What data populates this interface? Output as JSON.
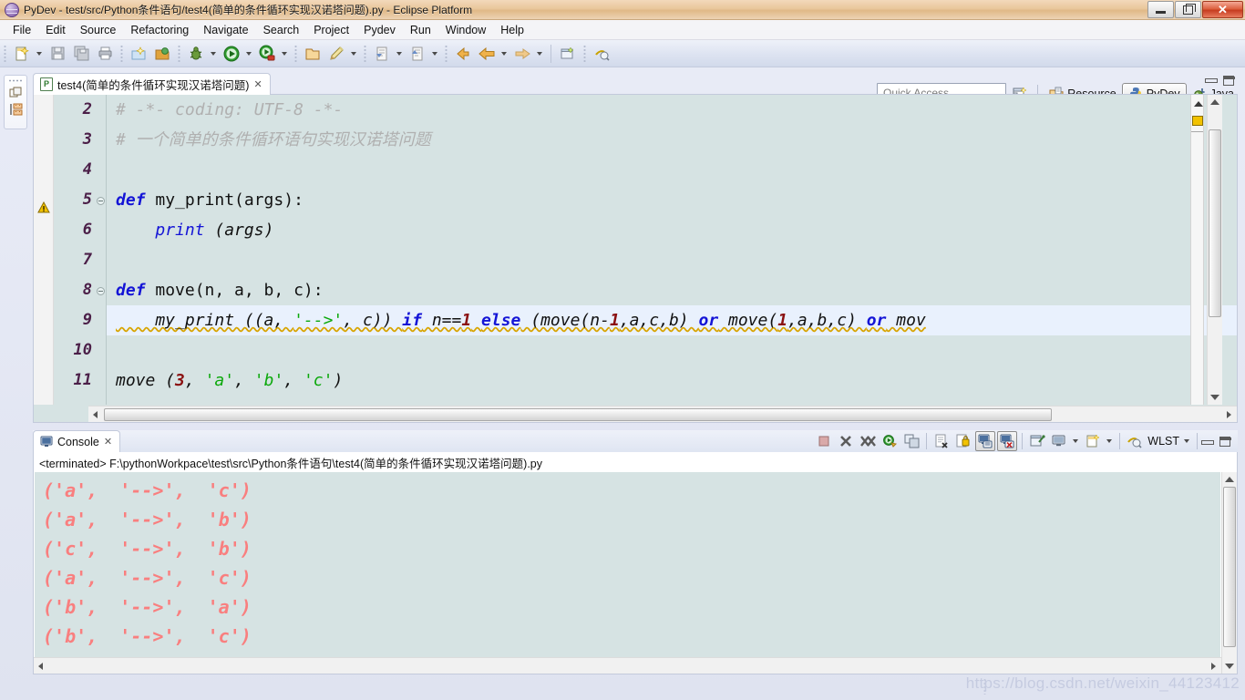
{
  "window": {
    "title": "PyDev - test/src/Python条件语句/test4(简单的条件循环实现汉诺塔问题).py - Eclipse Platform",
    "app_icon": "pydev-globe-icon",
    "minimize_label": "Minimize",
    "maximize_label": "Restore",
    "close_label": "Close"
  },
  "menubar": {
    "items": [
      {
        "label": "File"
      },
      {
        "label": "Edit"
      },
      {
        "label": "Source"
      },
      {
        "label": "Refactoring"
      },
      {
        "label": "Navigate"
      },
      {
        "label": "Search"
      },
      {
        "label": "Project"
      },
      {
        "label": "Pydev"
      },
      {
        "label": "Run"
      },
      {
        "label": "Window"
      },
      {
        "label": "Help"
      }
    ]
  },
  "toolbar": {
    "groups": [
      {
        "buttons": [
          {
            "name": "new-wizard-icon",
            "dropdown": true
          },
          {
            "name": "save-icon",
            "dropdown": false
          },
          {
            "name": "save-all-icon",
            "dropdown": false
          },
          {
            "name": "print-icon",
            "dropdown": false
          }
        ]
      },
      {
        "buttons": [
          {
            "name": "new-pydev-project-icon",
            "dropdown": false
          },
          {
            "name": "pydev-package-explorer-icon",
            "dropdown": false
          }
        ]
      },
      {
        "buttons": [
          {
            "name": "open-type-icon",
            "dropdown": false
          }
        ]
      },
      {
        "buttons": [
          {
            "name": "debug-icon",
            "dropdown": true
          },
          {
            "name": "run-icon",
            "dropdown": true
          },
          {
            "name": "run-external-tools-icon",
            "dropdown": true
          }
        ]
      },
      {
        "buttons": [
          {
            "name": "open-folder-icon",
            "dropdown": false
          },
          {
            "name": "pencil-edit-icon",
            "dropdown": true
          }
        ]
      },
      {
        "buttons": [
          {
            "name": "next-annotation-icon",
            "dropdown": true
          },
          {
            "name": "previous-annotation-icon",
            "dropdown": true
          }
        ]
      },
      {
        "buttons": [
          {
            "name": "back-history-icon",
            "dropdown": false
          },
          {
            "name": "back-arrow-icon",
            "dropdown": true
          },
          {
            "name": "forward-arrow-icon",
            "dropdown": true
          }
        ]
      },
      {
        "buttons": [
          {
            "name": "new-window-icon",
            "dropdown": false
          },
          {
            "name": "search-globe-icon",
            "dropdown": false
          }
        ]
      }
    ]
  },
  "quick_access": {
    "placeholder": "Quick Access",
    "value": ""
  },
  "perspectives": {
    "open_perspective_icon": "open-perspective-icon",
    "items": [
      {
        "label": "Resource",
        "icon": "resource-perspective-icon",
        "active": false
      },
      {
        "label": "PyDev",
        "icon": "pydev-perspective-icon",
        "active": true
      },
      {
        "label": "Java",
        "icon": "java-perspective-icon",
        "active": false
      }
    ]
  },
  "left_minimized_bar": {
    "items": [
      {
        "name": "restore-view-icon"
      },
      {
        "name": "outline-view-icon"
      }
    ]
  },
  "editor": {
    "tab": {
      "label": "test4(简单的条件循环实现汉诺塔问题)",
      "icon": "python-file-icon",
      "close_label": "✕"
    },
    "minimize_label": "Minimize",
    "maximize_label": "Maximize",
    "warning_tooltip": "warning-marker",
    "lines": [
      {
        "number": "2",
        "fold": false,
        "highlighted": false,
        "tokens": [
          {
            "text": "# -*- coding: UTF-8 -*-",
            "type": "comment"
          }
        ]
      },
      {
        "number": "3",
        "fold": false,
        "highlighted": false,
        "tokens": [
          {
            "text": "# 一个简单的条件循环语句实现汉诺塔问题",
            "type": "comment"
          }
        ]
      },
      {
        "number": "4",
        "fold": false,
        "highlighted": false,
        "tokens": [
          {
            "text": "",
            "type": "plain"
          }
        ]
      },
      {
        "number": "5",
        "fold": true,
        "highlighted": false,
        "tokens": [
          {
            "text": "def",
            "type": "kw"
          },
          {
            "text": " my_print(args):",
            "type": "fn"
          }
        ]
      },
      {
        "number": "6",
        "fold": false,
        "highlighted": false,
        "tokens": [
          {
            "text": "    ",
            "type": "plain"
          },
          {
            "text": "print",
            "type": "kw2"
          },
          {
            "text": " (args)",
            "type": "fn-i"
          }
        ]
      },
      {
        "number": "7",
        "fold": false,
        "highlighted": false,
        "tokens": [
          {
            "text": "",
            "type": "plain"
          }
        ]
      },
      {
        "number": "8",
        "fold": true,
        "highlighted": false,
        "tokens": [
          {
            "text": "def",
            "type": "kw"
          },
          {
            "text": " move(n, a, b, c):",
            "type": "fn"
          }
        ]
      },
      {
        "number": "9",
        "fold": false,
        "highlighted": true,
        "warning": true,
        "tokens": [
          {
            "text": "    my_print ((a, ",
            "type": "fn-i"
          },
          {
            "text": "'-->'",
            "type": "str"
          },
          {
            "text": ", c)) ",
            "type": "fn-i"
          },
          {
            "text": "if",
            "type": "kw"
          },
          {
            "text": " n==",
            "type": "fn-i"
          },
          {
            "text": "1",
            "type": "num"
          },
          {
            "text": " ",
            "type": "fn-i"
          },
          {
            "text": "else",
            "type": "kw"
          },
          {
            "text": " (move(n-",
            "type": "fn-i"
          },
          {
            "text": "1",
            "type": "num"
          },
          {
            "text": ",a,c,b) ",
            "type": "fn-i"
          },
          {
            "text": "or",
            "type": "kw"
          },
          {
            "text": " move(",
            "type": "fn-i"
          },
          {
            "text": "1",
            "type": "num"
          },
          {
            "text": ",a,b,c) ",
            "type": "fn-i"
          },
          {
            "text": "or",
            "type": "kw"
          },
          {
            "text": " mov",
            "type": "fn-i"
          }
        ]
      },
      {
        "number": "10",
        "fold": false,
        "highlighted": false,
        "tokens": [
          {
            "text": "",
            "type": "plain"
          }
        ]
      },
      {
        "number": "11",
        "fold": false,
        "highlighted": false,
        "tokens": [
          {
            "text": "move (",
            "type": "fn-i"
          },
          {
            "text": "3",
            "type": "num"
          },
          {
            "text": ", ",
            "type": "fn-i"
          },
          {
            "text": "'a'",
            "type": "str"
          },
          {
            "text": ", ",
            "type": "fn-i"
          },
          {
            "text": "'b'",
            "type": "str"
          },
          {
            "text": ", ",
            "type": "fn-i"
          },
          {
            "text": "'c'",
            "type": "str"
          },
          {
            "text": ")",
            "type": "fn-i"
          }
        ]
      }
    ]
  },
  "console": {
    "tab": {
      "label": "Console",
      "icon": "console-icon",
      "close_label": "✕"
    },
    "toolbar": {
      "buttons": [
        {
          "name": "terminate-icon",
          "pressed": false
        },
        {
          "name": "remove-launch-icon",
          "pressed": false
        },
        {
          "name": "remove-all-terminated-icon",
          "pressed": false
        },
        {
          "name": "relaunch-icon",
          "pressed": false
        },
        {
          "name": "new-console-view-icon",
          "pressed": false
        },
        {
          "name": "clear-console-icon",
          "pressed": false
        },
        {
          "name": "scroll-lock-icon",
          "pressed": false
        },
        {
          "name": "show-console-on-output-icon",
          "pressed": true
        },
        {
          "name": "show-console-on-error-icon",
          "pressed": true
        },
        {
          "name": "pin-console-icon",
          "pressed": false
        },
        {
          "name": "display-selected-console-icon",
          "pressed": false
        },
        {
          "name": "open-console-icon",
          "pressed": false
        }
      ],
      "wlst_label": "WLST",
      "minimize_label": "Minimize",
      "maximize_label": "Maximize"
    },
    "terminated_line": "<terminated> F:\\pythonWorkpace\\test\\src\\Python条件语句\\test4(简单的条件循环实现汉诺塔问题).py",
    "output_color": "#f97f7f",
    "output": [
      "('a',  '-->',  'c')",
      "('a',  '-->',  'b')",
      "('c',  '-->',  'b')",
      "('a',  '-->',  'c')",
      "('b',  '-->',  'a')",
      "('b',  '-->',  'c')"
    ]
  },
  "watermark": {
    "text": "https://blog.csdn.net/weixin_44123412"
  },
  "colors": {
    "editor_background": "#d6e3e3",
    "current_line": "#e9f1fd",
    "keyword": "#1414d6",
    "string": "#0aa80a",
    "number": "#8a1010",
    "comment": "#b0b0b0",
    "linenumber": "#4b1f48",
    "titlebar": "#e9c79c"
  }
}
